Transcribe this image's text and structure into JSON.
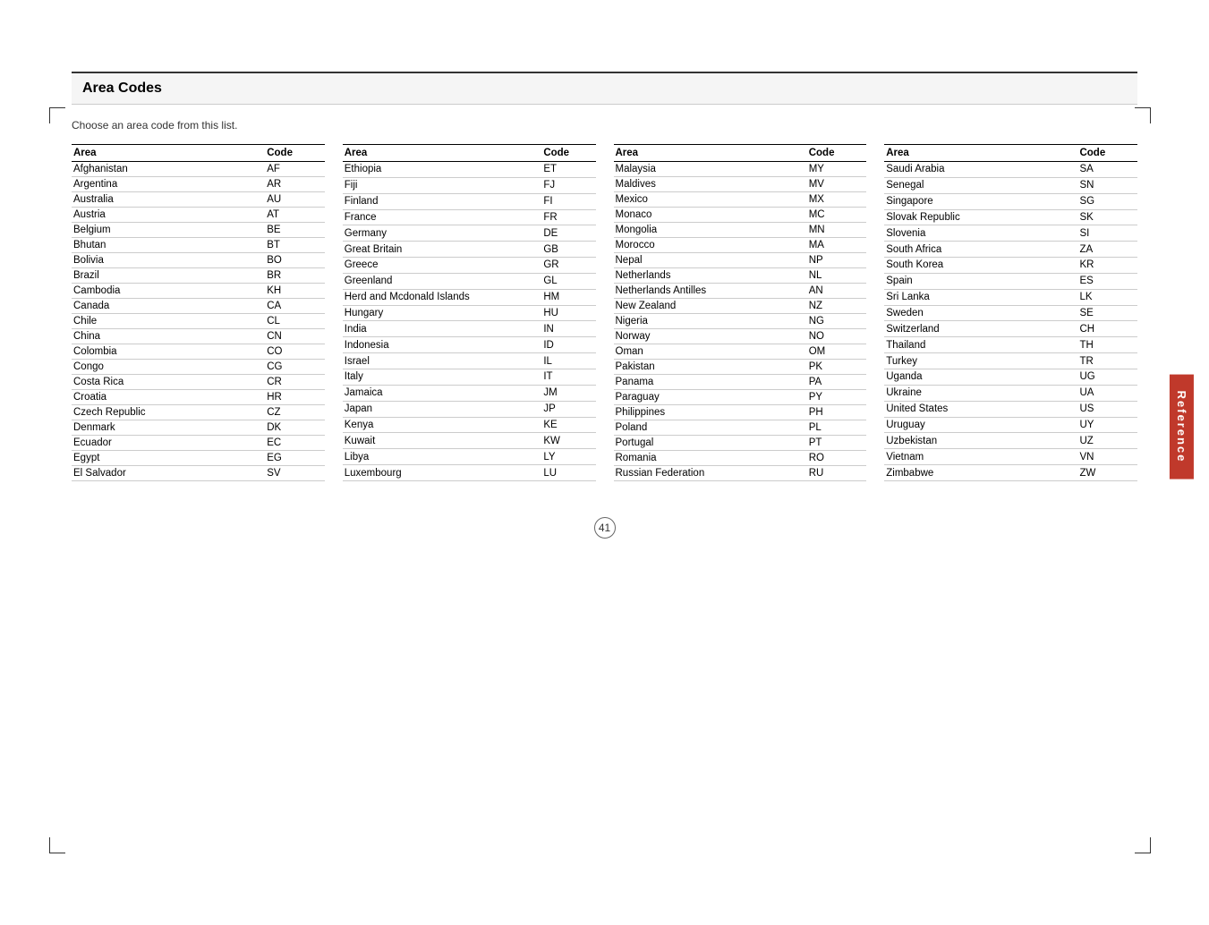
{
  "page": {
    "title": "Area Codes",
    "subtitle": "Choose an area code from this list.",
    "page_number": "41",
    "reference_tab": "Reference"
  },
  "columns": [
    {
      "header_area": "Area",
      "header_code": "Code",
      "rows": [
        {
          "area": "Afghanistan",
          "code": "AF"
        },
        {
          "area": "Argentina",
          "code": "AR"
        },
        {
          "area": "Australia",
          "code": "AU"
        },
        {
          "area": "Austria",
          "code": "AT"
        },
        {
          "area": "Belgium",
          "code": "BE"
        },
        {
          "area": "Bhutan",
          "code": "BT"
        },
        {
          "area": "Bolivia",
          "code": "BO"
        },
        {
          "area": "Brazil",
          "code": "BR"
        },
        {
          "area": "Cambodia",
          "code": "KH"
        },
        {
          "area": "Canada",
          "code": "CA"
        },
        {
          "area": "Chile",
          "code": "CL"
        },
        {
          "area": "China",
          "code": "CN"
        },
        {
          "area": "Colombia",
          "code": "CO"
        },
        {
          "area": "Congo",
          "code": "CG"
        },
        {
          "area": "Costa Rica",
          "code": "CR"
        },
        {
          "area": "Croatia",
          "code": "HR"
        },
        {
          "area": "Czech Republic",
          "code": "CZ"
        },
        {
          "area": "Denmark",
          "code": "DK"
        },
        {
          "area": "Ecuador",
          "code": "EC"
        },
        {
          "area": "Egypt",
          "code": "EG"
        },
        {
          "area": "El Salvador",
          "code": "SV"
        }
      ]
    },
    {
      "header_area": "Area",
      "header_code": "Code",
      "rows": [
        {
          "area": "Ethiopia",
          "code": "ET"
        },
        {
          "area": "Fiji",
          "code": "FJ"
        },
        {
          "area": "Finland",
          "code": "FI"
        },
        {
          "area": "France",
          "code": "FR"
        },
        {
          "area": "Germany",
          "code": "DE"
        },
        {
          "area": "Great Britain",
          "code": "GB"
        },
        {
          "area": "Greece",
          "code": "GR"
        },
        {
          "area": "Greenland",
          "code": "GL"
        },
        {
          "area": "Herd and Mcdonald Islands",
          "code": "HM"
        },
        {
          "area": "Hungary",
          "code": "HU"
        },
        {
          "area": "India",
          "code": "IN"
        },
        {
          "area": "Indonesia",
          "code": "ID"
        },
        {
          "area": "Israel",
          "code": "IL"
        },
        {
          "area": "Italy",
          "code": "IT"
        },
        {
          "area": "Jamaica",
          "code": "JM"
        },
        {
          "area": "Japan",
          "code": "JP"
        },
        {
          "area": "Kenya",
          "code": "KE"
        },
        {
          "area": "Kuwait",
          "code": "KW"
        },
        {
          "area": "Libya",
          "code": "LY"
        },
        {
          "area": "Luxembourg",
          "code": "LU"
        }
      ]
    },
    {
      "header_area": "Area",
      "header_code": "Code",
      "rows": [
        {
          "area": "Malaysia",
          "code": "MY"
        },
        {
          "area": "Maldives",
          "code": "MV"
        },
        {
          "area": "Mexico",
          "code": "MX"
        },
        {
          "area": "Monaco",
          "code": "MC"
        },
        {
          "area": "Mongolia",
          "code": "MN"
        },
        {
          "area": "Morocco",
          "code": "MA"
        },
        {
          "area": "Nepal",
          "code": "NP"
        },
        {
          "area": "Netherlands",
          "code": "NL"
        },
        {
          "area": "Netherlands Antilles",
          "code": "AN"
        },
        {
          "area": "New Zealand",
          "code": "NZ"
        },
        {
          "area": "Nigeria",
          "code": "NG"
        },
        {
          "area": "Norway",
          "code": "NO"
        },
        {
          "area": "Oman",
          "code": "OM"
        },
        {
          "area": "Pakistan",
          "code": "PK"
        },
        {
          "area": "Panama",
          "code": "PA"
        },
        {
          "area": "Paraguay",
          "code": "PY"
        },
        {
          "area": "Philippines",
          "code": "PH"
        },
        {
          "area": "Poland",
          "code": "PL"
        },
        {
          "area": "Portugal",
          "code": "PT"
        },
        {
          "area": "Romania",
          "code": "RO"
        },
        {
          "area": "Russian Federation",
          "code": "RU"
        }
      ]
    },
    {
      "header_area": "Area",
      "header_code": "Code",
      "rows": [
        {
          "area": "Saudi Arabia",
          "code": "SA"
        },
        {
          "area": "Senegal",
          "code": "SN"
        },
        {
          "area": "Singapore",
          "code": "SG"
        },
        {
          "area": "Slovak Republic",
          "code": "SK"
        },
        {
          "area": "Slovenia",
          "code": "SI"
        },
        {
          "area": "South Africa",
          "code": "ZA"
        },
        {
          "area": "South Korea",
          "code": "KR"
        },
        {
          "area": "Spain",
          "code": "ES"
        },
        {
          "area": "Sri Lanka",
          "code": "LK"
        },
        {
          "area": "Sweden",
          "code": "SE"
        },
        {
          "area": "Switzerland",
          "code": "CH"
        },
        {
          "area": "Thailand",
          "code": "TH"
        },
        {
          "area": "Turkey",
          "code": "TR"
        },
        {
          "area": "Uganda",
          "code": "UG"
        },
        {
          "area": "Ukraine",
          "code": "UA"
        },
        {
          "area": "United States",
          "code": "US"
        },
        {
          "area": "Uruguay",
          "code": "UY"
        },
        {
          "area": "Uzbekistan",
          "code": "UZ"
        },
        {
          "area": "Vietnam",
          "code": "VN"
        },
        {
          "area": "Zimbabwe",
          "code": "ZW"
        }
      ]
    }
  ]
}
